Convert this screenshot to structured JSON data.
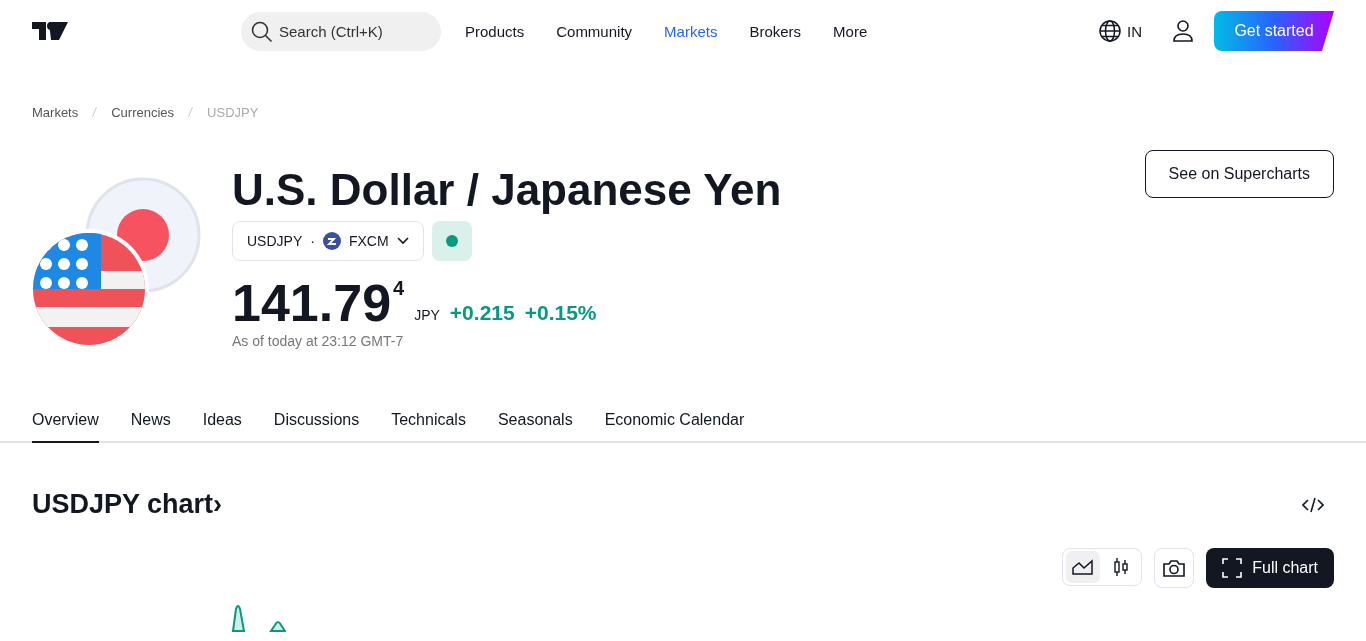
{
  "header": {
    "search": {
      "placeholder": "Search (Ctrl+K)"
    },
    "nav": [
      {
        "label": "Products",
        "selected": false
      },
      {
        "label": "Community",
        "selected": false
      },
      {
        "label": "Markets",
        "selected": true
      },
      {
        "label": "Brokers",
        "selected": false
      },
      {
        "label": "More",
        "selected": false
      }
    ],
    "region": "IN",
    "cta": "Get started"
  },
  "breadcrumbs": [
    "Markets",
    "Currencies",
    "USDJPY"
  ],
  "symbol": {
    "title": "U.S. Dollar / Japanese Yen",
    "ticker": "USDJPY",
    "separator": "·",
    "exchange": "FXCM",
    "price": "141.79",
    "price_last_digit": "4",
    "currency": "JPY",
    "change": "+0.215",
    "change_percent": "+0.15%",
    "as_of": "As of today at 23:12 GMT-7",
    "supercharts": "See on Supercharts"
  },
  "tabs": [
    {
      "label": "Overview",
      "selected": true
    },
    {
      "label": "News",
      "selected": false
    },
    {
      "label": "Ideas",
      "selected": false
    },
    {
      "label": "Discussions",
      "selected": false
    },
    {
      "label": "Technicals",
      "selected": false
    },
    {
      "label": "Seasonals",
      "selected": false
    },
    {
      "label": "Economic Calendar",
      "selected": false
    }
  ],
  "chart": {
    "title": "USDJPY chart",
    "arrow": "›",
    "types": [
      {
        "kind": "area",
        "selected": true
      },
      {
        "kind": "candles",
        "selected": false
      }
    ],
    "full_chart": "Full chart"
  }
}
